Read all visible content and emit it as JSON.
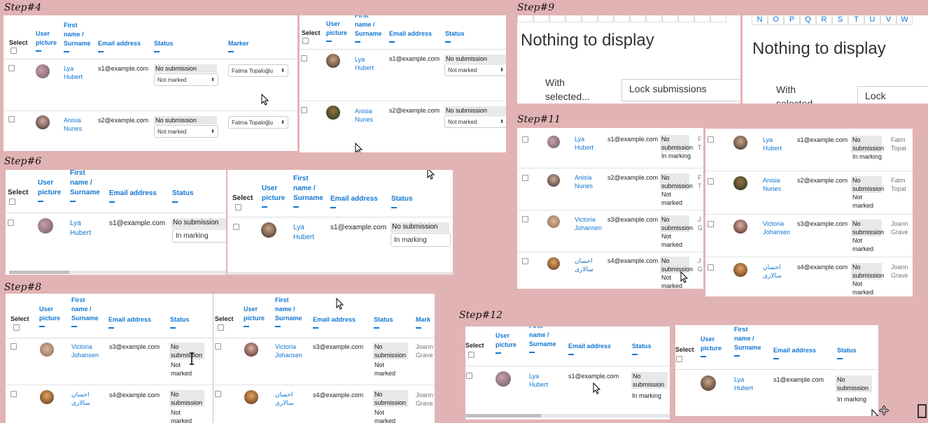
{
  "steps": {
    "s4": "Step#4",
    "s6": "Step#6",
    "s8": "Step#8",
    "s9": "Step#9",
    "s11": "Step#11",
    "s12": "Step#12"
  },
  "headers": {
    "select": "Select",
    "user_picture": [
      "User",
      "picture"
    ],
    "first_name": [
      "First",
      "name /",
      "Surname"
    ],
    "email": "Email address",
    "status": "Status",
    "marker": "Marker",
    "marker_short": "Mark"
  },
  "users": {
    "lya": {
      "name": [
        "Lya",
        "Hubert"
      ],
      "email": "s1@example.com"
    },
    "anisia": {
      "name": [
        "Anisia",
        "Nunes"
      ],
      "email": "s2@example.com"
    },
    "victoria": {
      "name": [
        "Victoria",
        "Johansen"
      ],
      "email": "s3@example.com"
    },
    "ehsan": {
      "name": [
        "احسان",
        "سالاری"
      ],
      "email": "s4@example.com"
    }
  },
  "status": {
    "no_submission": "No submission",
    "no": "No",
    "submission": "submission",
    "not_marked": "Not marked",
    "not": "Not",
    "marked": "marked",
    "in_marking": "In marking"
  },
  "markers": {
    "fatma": "Fatma Topaloğlu",
    "fatm": "Fatm",
    "topal": "Topal",
    "joann": "Joann",
    "grave": "Grave",
    "f": "F",
    "t": "T",
    "j": "J",
    "g": "G"
  },
  "step9": {
    "nothing": "Nothing to display",
    "with": "With",
    "selected": "selected...",
    "selected_cut": "selected",
    "lock": "Lock submissions",
    "lock_cut": "Lock submissio",
    "letters": [
      "N",
      "O",
      "P",
      "Q",
      "R",
      "S",
      "T",
      "U",
      "V",
      "W"
    ]
  },
  "colors": {
    "background": "#e2b3b4",
    "link": "#1177d1",
    "status_bg": "#e8e8e8"
  }
}
